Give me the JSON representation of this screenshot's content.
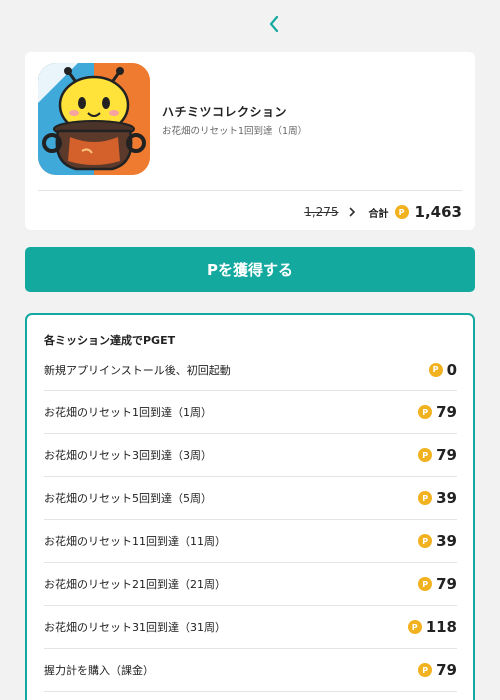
{
  "nav": {
    "back_icon": "chevron-left-icon"
  },
  "app": {
    "name": "ハチミツコレクション",
    "subtitle": "お花畑のリセット1回到達（1周）",
    "icon": "bee-honey-pot-app-icon"
  },
  "pricing": {
    "old_price": "1,275",
    "total_label": "合計",
    "coin_symbol": "P",
    "total_value": "1,463"
  },
  "cta": {
    "label": "Pを獲得する"
  },
  "missions": {
    "title": "各ミッション達成でPGET",
    "items": [
      {
        "label": "新規アプリインストール後、初回起動",
        "points": "0"
      },
      {
        "label": "お花畑のリセット1回到達（1周）",
        "points": "79"
      },
      {
        "label": "お花畑のリセット3回到達（3周）",
        "points": "79"
      },
      {
        "label": "お花畑のリセット5回到達（5周）",
        "points": "39"
      },
      {
        "label": "お花畑のリセット11回到達（11周）",
        "points": "39"
      },
      {
        "label": "お花畑のリセット21回到達（21周）",
        "points": "79"
      },
      {
        "label": "お花畑のリセット31回到達（31周）",
        "points": "118"
      },
      {
        "label": "握力計を購入（課金）",
        "points": "79"
      }
    ]
  },
  "colors": {
    "accent": "#14a99f",
    "coin": "#f2b21f",
    "background": "#f2f2f2"
  }
}
